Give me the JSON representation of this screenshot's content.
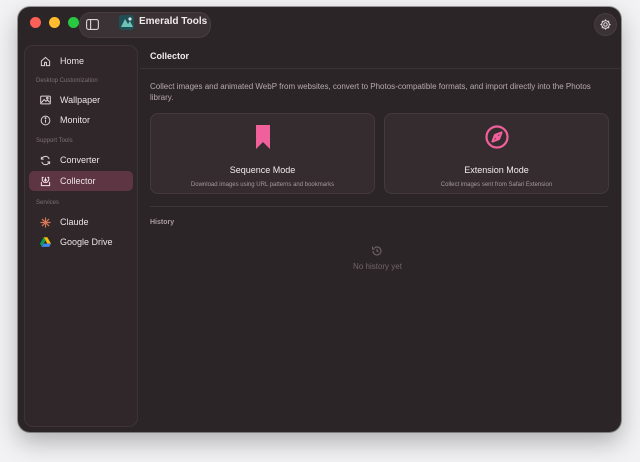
{
  "app": {
    "title": "Emerald Tools",
    "icons": {
      "sidebar_toggle": "sidebar-toggle-icon",
      "app": "app-icon",
      "settings": "gear-icon"
    }
  },
  "sidebar": {
    "home": {
      "label": "Home",
      "icon": "home-icon"
    },
    "sections": [
      {
        "title": "Desktop Customization",
        "items": [
          {
            "label": "Wallpaper",
            "icon": "image-icon"
          },
          {
            "label": "Monitor",
            "icon": "info-icon"
          }
        ]
      },
      {
        "title": "Support Tools",
        "items": [
          {
            "label": "Converter",
            "icon": "convert-arrows-icon"
          },
          {
            "label": "Collector",
            "icon": "download-tray-icon",
            "active": true
          }
        ]
      },
      {
        "title": "Services",
        "items": [
          {
            "label": "Claude",
            "icon": "claude-sparkle-icon"
          },
          {
            "label": "Google Drive",
            "icon": "google-drive-icon"
          }
        ]
      }
    ]
  },
  "main": {
    "title": "Collector",
    "description": "Collect images and animated WebP from websites, convert to Photos-compatible formats, and import directly into the Photos library.",
    "cards": [
      {
        "title": "Sequence Mode",
        "desc": "Download images using URL patterns and bookmarks",
        "icon": "bookmark-icon"
      },
      {
        "title": "Extension Mode",
        "desc": "Collect images sent from Safari Extension",
        "icon": "compass-icon"
      }
    ],
    "history": {
      "label": "History",
      "empty_text": "No history yet",
      "icon": "history-clock-icon"
    }
  },
  "colors": {
    "accent": "#f0609a",
    "active_bg": "#5e3542",
    "window_bg": "#2c2527"
  }
}
